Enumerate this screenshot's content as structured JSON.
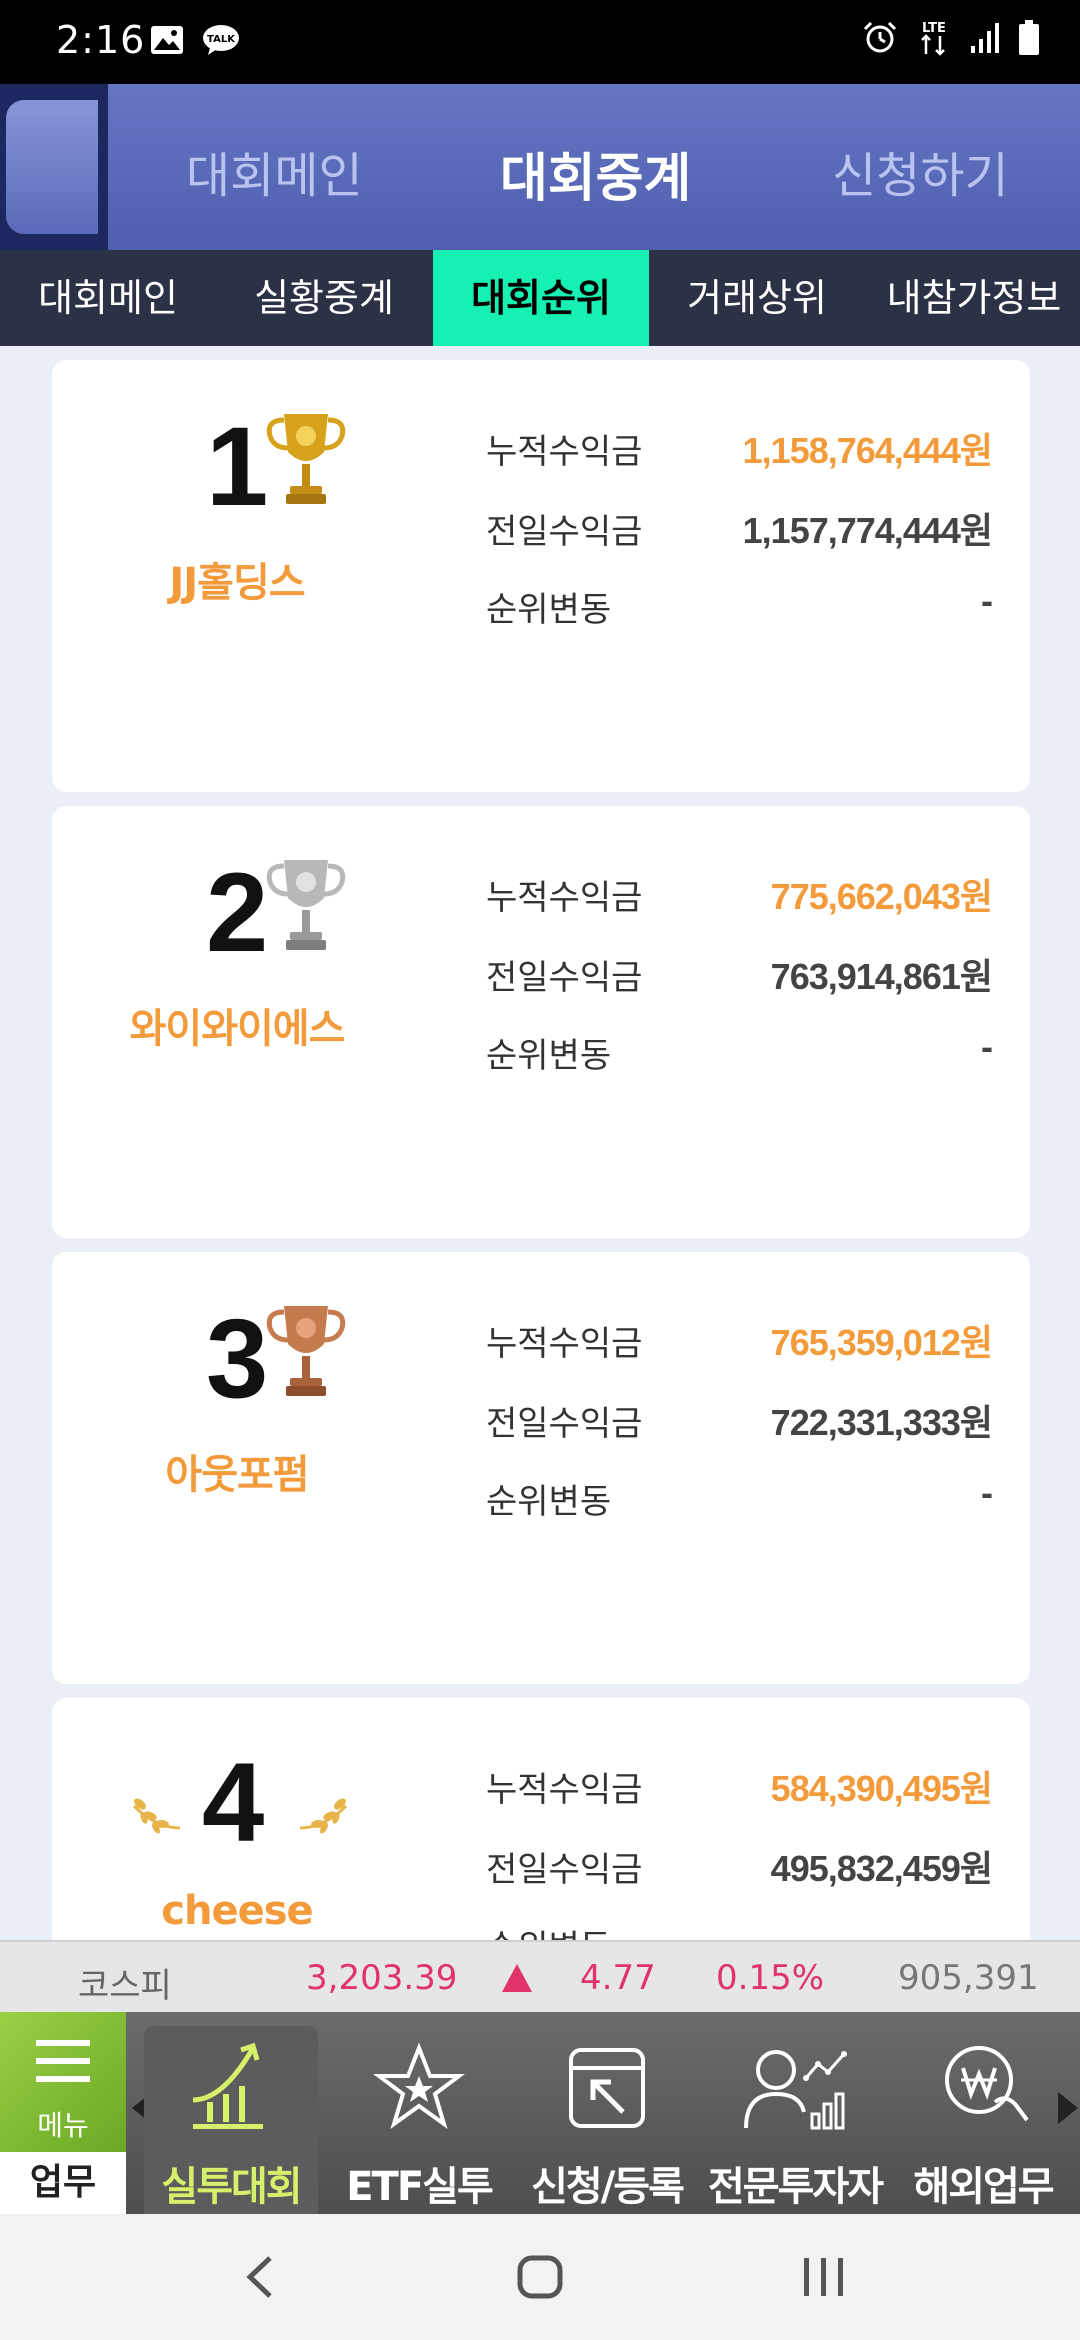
{
  "status_bar": {
    "time": "2:16",
    "left_icons": [
      "gallery-icon",
      "talk-icon"
    ],
    "right_icons": [
      "alarm-icon",
      "lte-icon",
      "signal-icon",
      "battery-icon"
    ],
    "lte_text": "LTE"
  },
  "header": {
    "tabs": [
      {
        "label": "대회메인",
        "active": false
      },
      {
        "label": "대회중계",
        "active": true
      },
      {
        "label": "신청하기",
        "active": false
      }
    ]
  },
  "subnav": {
    "items": [
      {
        "label": "대회메인",
        "active": false
      },
      {
        "label": "실황중계",
        "active": false
      },
      {
        "label": "대회순위",
        "active": true
      },
      {
        "label": "거래상위",
        "active": false
      },
      {
        "label": "내참가정보",
        "active": false
      }
    ]
  },
  "labels": {
    "cumulative": "누적수익금",
    "previous_day": "전일수익금",
    "rank_change": "순위변동"
  },
  "rankings": [
    {
      "rank": "1",
      "team": "JJ홀딩스",
      "badge": "gold-trophy-icon",
      "cumulative": "1,158,764,444원",
      "previous_day": "1,157,774,444원",
      "rank_change": "-"
    },
    {
      "rank": "2",
      "team": "와이와이에스",
      "badge": "silver-trophy-icon",
      "cumulative": "775,662,043원",
      "previous_day": "763,914,861원",
      "rank_change": "-"
    },
    {
      "rank": "3",
      "team": "아웃포펌",
      "badge": "bronze-trophy-icon",
      "cumulative": "765,359,012원",
      "previous_day": "722,331,333원",
      "rank_change": "-"
    },
    {
      "rank": "4",
      "team": "cheese",
      "badge": "laurel-icon",
      "cumulative": "584,390,495원",
      "previous_day": "495,832,459원",
      "rank_change": ""
    }
  ],
  "ticker": {
    "index_name": "코스피",
    "index_value": "3,203.39",
    "change": "4.77",
    "change_pct": "0.15%",
    "volume": "905,391",
    "up_color": "#e0336a"
  },
  "bottom_menu": {
    "menu_label": "메뉴",
    "menu_section": "업무",
    "items": [
      {
        "label": "실투대회",
        "icon": "chart-up-icon",
        "active": true
      },
      {
        "label": "ETF실투",
        "icon": "star-icon",
        "active": false
      },
      {
        "label": "신청/등록",
        "icon": "apply-arrow-icon",
        "active": false
      },
      {
        "label": "전문투자자",
        "icon": "investor-icon",
        "active": false
      },
      {
        "label": "해외업무",
        "icon": "won-hand-icon",
        "active": false
      }
    ]
  },
  "colors": {
    "accent_green": "#16f0b3",
    "orange": "#f39a3a",
    "header_blue": "#5a6ab8",
    "menu_green": "#7ab82e"
  }
}
